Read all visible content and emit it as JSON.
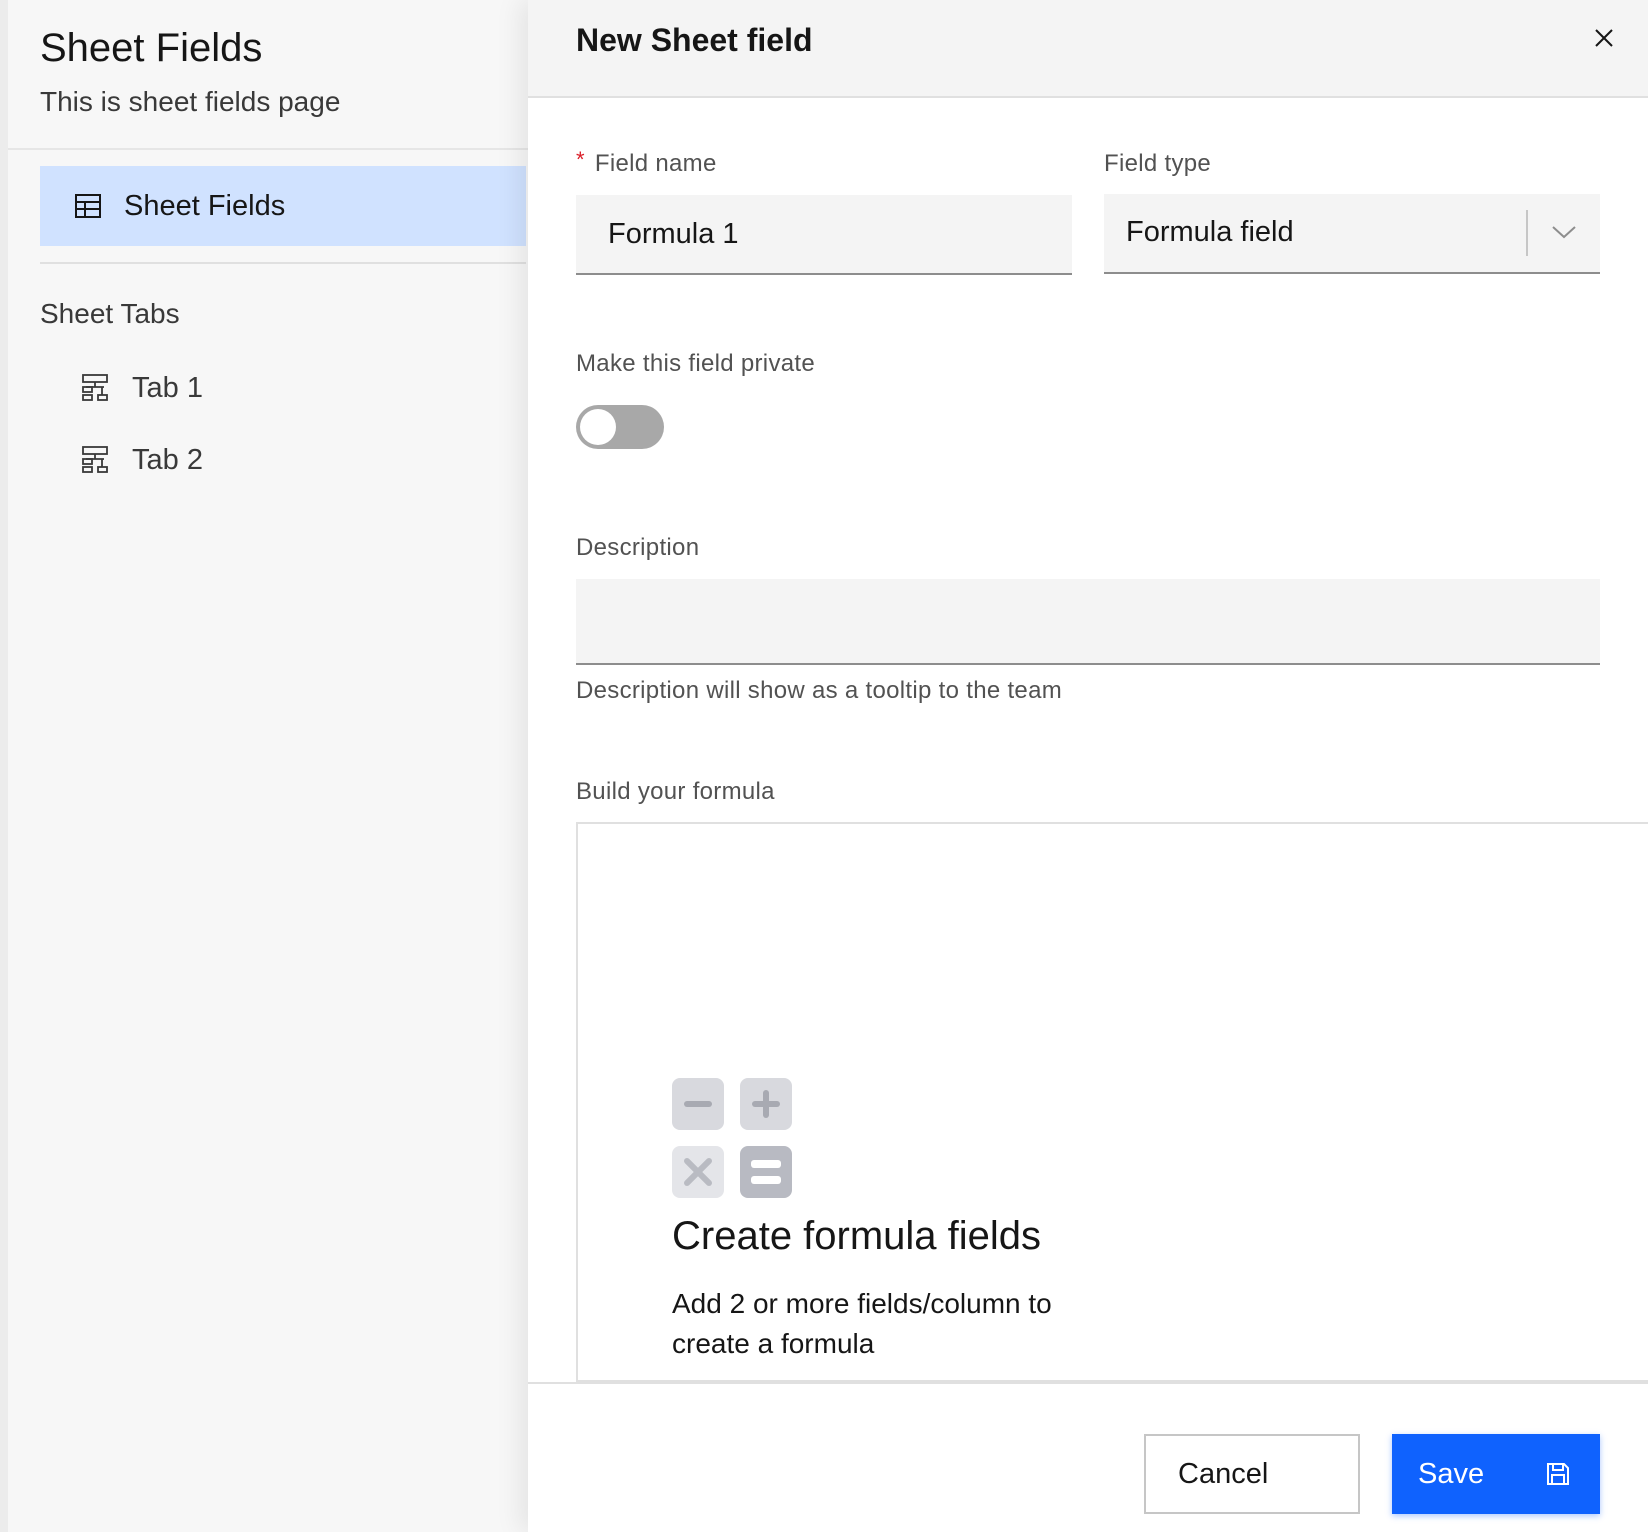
{
  "sidebar": {
    "title": "Sheet Fields",
    "subtitle": "This is sheet fields page",
    "active_item": {
      "label": "Sheet Fields",
      "icon": "table-icon"
    },
    "section_heading": "Sheet Tabs",
    "tabs": [
      {
        "label": "Tab 1",
        "icon": "tree-view-icon"
      },
      {
        "label": "Tab 2",
        "icon": "tree-view-icon"
      }
    ]
  },
  "panel": {
    "title": "New Sheet field",
    "close_icon": "close-icon",
    "field_name": {
      "label": "Field name",
      "required_mark": "*",
      "value": "Formula 1"
    },
    "field_type": {
      "label": "Field type",
      "value": "Formula field"
    },
    "private_toggle": {
      "label": "Make this field private",
      "state": "off"
    },
    "description": {
      "label": "Description",
      "value": "",
      "helper": "Description will show as a tooltip to the team"
    },
    "formula": {
      "label": "Build your formula",
      "empty_icon": "calculator-icon",
      "empty_title": "Create formula fields",
      "empty_body": "Add 2 or more fields/column to create a formula"
    },
    "footer": {
      "cancel_label": "Cancel",
      "save_label": "Save",
      "save_icon": "save-icon"
    }
  },
  "colors": {
    "primary": "#0f62fe",
    "active_nav": "#d0e2ff",
    "required": "#da1e28",
    "toggle_off": "#a8a8a8"
  }
}
